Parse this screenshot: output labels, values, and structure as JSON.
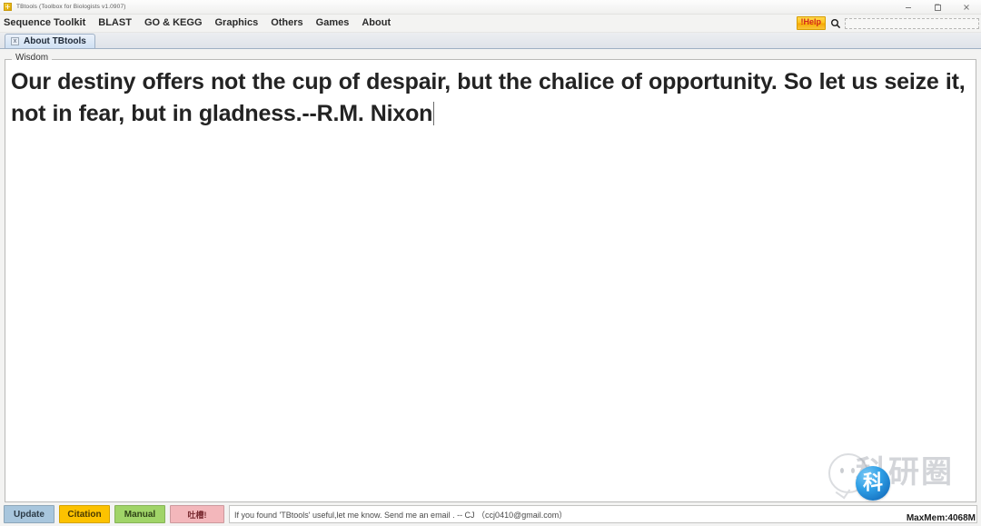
{
  "window": {
    "title": "TBtools (Toolbox for Biologists v1.0907)",
    "icon": "tbtools-logo-icon",
    "controls": {
      "minimize": "minimize-icon",
      "maximize": "maximize-icon",
      "close": "close-icon"
    }
  },
  "menubar": {
    "items": [
      {
        "label": "Sequence Toolkit"
      },
      {
        "label": "BLAST"
      },
      {
        "label": "GO & KEGG"
      },
      {
        "label": "Graphics"
      },
      {
        "label": "Others"
      },
      {
        "label": "Games"
      },
      {
        "label": "About"
      }
    ],
    "help_label": "!Help",
    "help_bg": "#ffc21e",
    "help_color": "#d2261c",
    "search_icon": "search-icon",
    "search_value": "",
    "search_placeholder": ""
  },
  "tabs": [
    {
      "label": "About TBtools",
      "close_label": "x",
      "active": true
    }
  ],
  "panel": {
    "group_title": "Wisdom",
    "wisdom_text": "Our destiny offers not the cup of despair, but the chalice of opportunity. So let us seize it, not in fear, but in gladness.--R.M. Nixon"
  },
  "bottombar": {
    "buttons": [
      {
        "label": "Update",
        "color": "#a8c6dd"
      },
      {
        "label": "Citation",
        "color": "#fcc200"
      },
      {
        "label": "Manual",
        "color": "#a0d468"
      },
      {
        "label": "吐槽!",
        "color": "#f3b7bb"
      }
    ],
    "status_text": "If you found 'TBtools' useful,let me know. Send me an email . -- CJ （ccj0410@gmail.com）",
    "max_mem": "MaxMem:4068M"
  },
  "watermark": {
    "text": "科研圈",
    "badge_char": "科"
  }
}
